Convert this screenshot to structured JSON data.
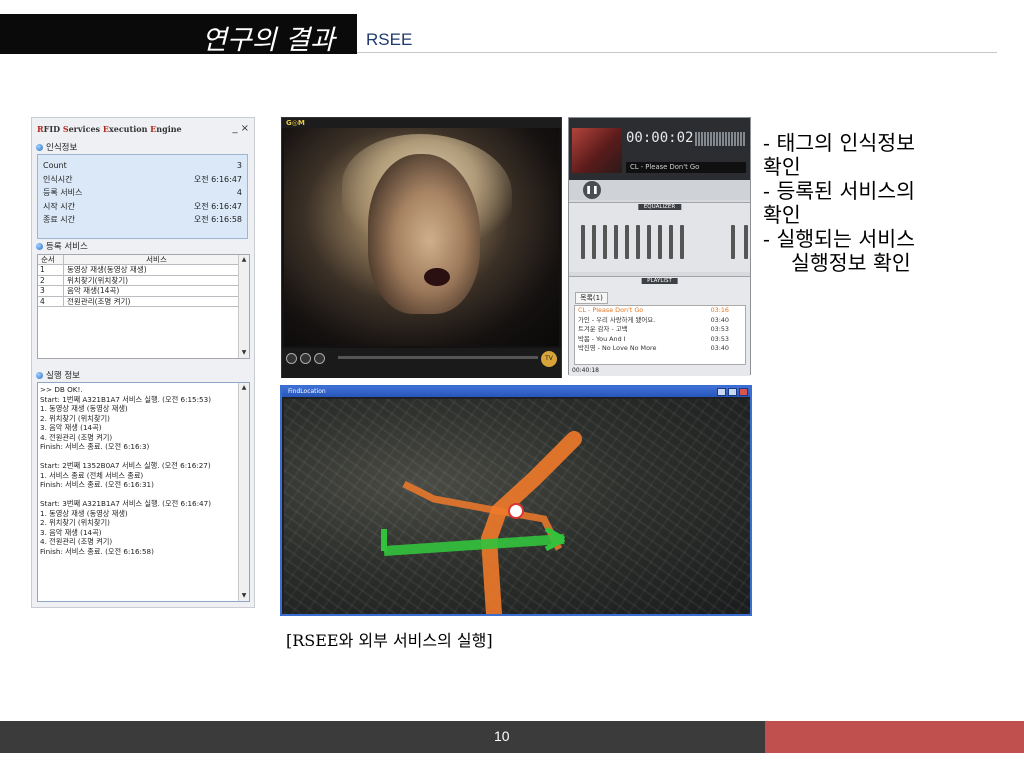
{
  "header": {
    "title": "연구의 결과",
    "subtitle": "RSEE"
  },
  "rfid_panel": {
    "title_parts": [
      "R",
      "FID ",
      "S",
      "ervices ",
      "E",
      "xecution ",
      "E",
      "ngine"
    ],
    "window_controls": "_ ×",
    "recognition_section": "인식정보",
    "recognition_rows": [
      {
        "label": "Count",
        "value": "3"
      },
      {
        "label": "인식시간",
        "value": "오전 6:16:47"
      },
      {
        "label": "등록 서비스",
        "value": "4"
      },
      {
        "label": "시작 시간",
        "value": "오전 6:16:47"
      },
      {
        "label": "종료 시간",
        "value": "오전 6:16:58"
      }
    ],
    "services_section": "등록 서비스",
    "services_headers": [
      "순서",
      "서비스"
    ],
    "services_rows": [
      {
        "no": "1",
        "name": "동영상 재생(동영상 재생)"
      },
      {
        "no": "2",
        "name": "위치찾기(위치찾기)"
      },
      {
        "no": "3",
        "name": "음악 재생(14곡)"
      },
      {
        "no": "4",
        "name": "전원관리(조명 켜기)"
      }
    ],
    "log_section": "실행 정보",
    "log_lines": [
      ">> DB OK!.",
      "Start: 1번째 A321B1A7 서비스 실행. (오전 6:15:53)",
      "1.   동영상 재생 (동영상 재생)",
      "2.   위치찾기 (위치찾기)",
      "3.   음악 재생 (14곡)",
      "4.   전원관리 (조명 켜기)",
      "Finish: 서비스 종료. (오전 6:16:3)",
      "",
      "Start: 2번째 1352B0A7 서비스 실행. (오전 6:16:27)",
      "1.   서비스 종료 (전체 서비스 종료)",
      "Finish: 서비스 종료. (오전 6:16:31)",
      "",
      "Start: 3번째 A321B1A7 서비스 실행. (오전 6:16:47)",
      "1.   동영상 재생 (동영상 재생)",
      "2.   위치찾기 (위치찾기)",
      "3.   음악 재생 (14곡)",
      "4.   전원관리 (조명 켜기)",
      "Finish: 서비스 종료. (오전 6:16:58)"
    ]
  },
  "music_player": {
    "time": "00:00:02",
    "now_playing": "CL - Please Don't Go",
    "equalizer_label": "EQUALIZER",
    "playlist_label": "PLAYLIST",
    "playlist_tab": "목록(1)",
    "playlist": [
      {
        "title": "CL - Please Don't Go",
        "time": "03:16",
        "active": true
      },
      {
        "title": "가인 - 우리 사랑하게 됐어요.",
        "time": "03:40",
        "active": false
      },
      {
        "title": "트겨운 감자  - 고백",
        "time": "03:53",
        "active": false
      },
      {
        "title": "박봄 - You And I",
        "time": "03:53",
        "active": false
      },
      {
        "title": "박진영 - No Love No More",
        "time": "03:40",
        "active": false
      }
    ],
    "total_time": "00:40:18"
  },
  "bullets": [
    {
      "text": "- 태그의 인식정보",
      "indent": false
    },
    {
      "text": "확인",
      "indent": false
    },
    {
      "text": "- 등록된 서비스의",
      "indent": false
    },
    {
      "text": "확인",
      "indent": false
    },
    {
      "text": "- 실행되는 서비스",
      "indent": false
    },
    {
      "text": "실행정보 확인",
      "indent": true
    }
  ],
  "map": {
    "window_title": "FindLocation"
  },
  "caption": "[RSEE와 외부 서비스의 실행]",
  "footer": {
    "page_number": "10"
  },
  "colors": {
    "footer_bg": "#3b3b3b",
    "footer_accent": "#c0504d",
    "subtitle": "#1f3a6e",
    "route_orange": "#f07a2a",
    "route_green": "#32c33c"
  }
}
